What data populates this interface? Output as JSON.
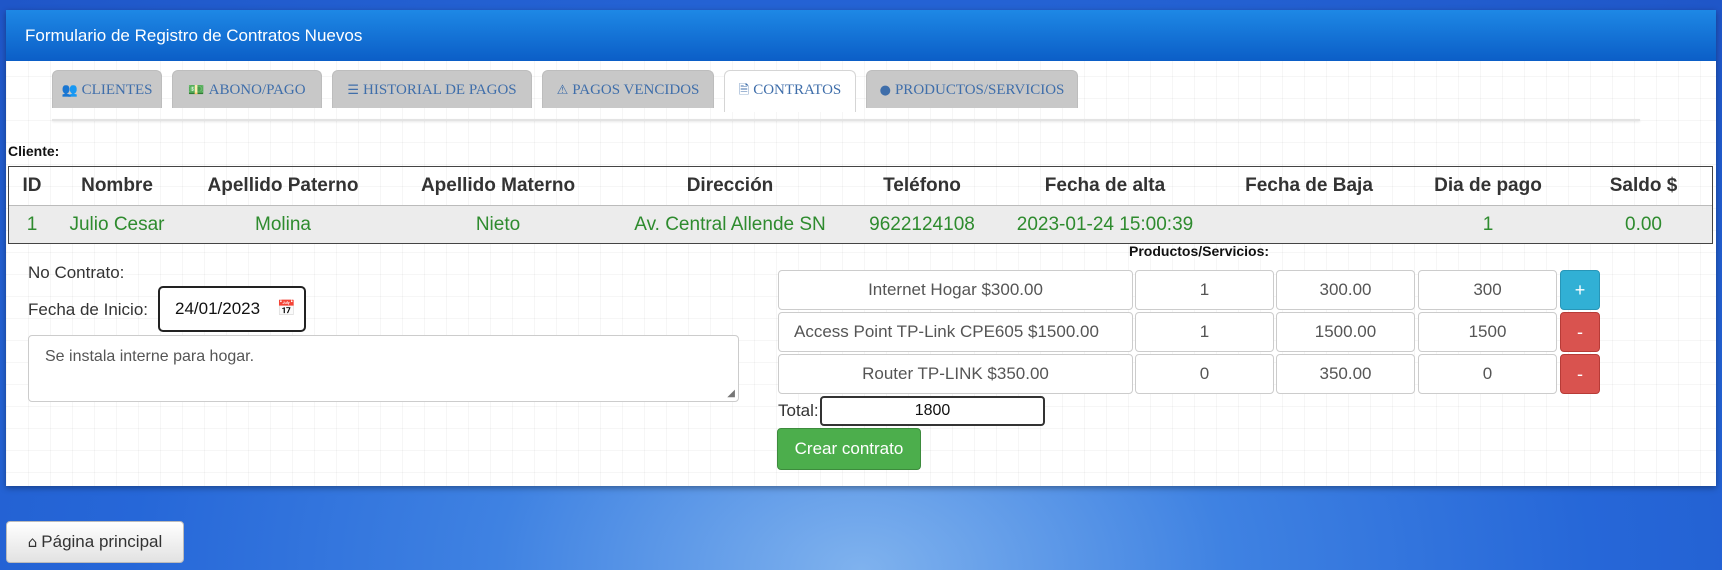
{
  "window": {
    "title": "Formulario de Registro de Contratos Nuevos"
  },
  "tabs": [
    {
      "label": "CLIENTES",
      "icon": "users-icon",
      "glyph": "👥"
    },
    {
      "label": "ABONO/PAGO",
      "icon": "money-icon",
      "glyph": "💵"
    },
    {
      "label": "HISTORIAL DE PAGOS",
      "icon": "list-icon",
      "glyph": "☰"
    },
    {
      "label": "PAGOS VENCIDOS",
      "icon": "warning-icon",
      "glyph": "⚠"
    },
    {
      "label": "CONTRATOS",
      "icon": "document-icon",
      "glyph": "🗎",
      "active": true
    },
    {
      "label": "PRODUCTOS/SERVICIOS",
      "icon": "apple-icon",
      "glyph": "●"
    }
  ],
  "cliente": {
    "label": "Cliente:",
    "headers": [
      "ID",
      "Nombre",
      "Apellido Paterno",
      "Apellido Materno",
      "Dirección",
      "Teléfono",
      "Fecha de alta",
      "Fecha de Baja",
      "Dia de pago",
      "Saldo $"
    ],
    "row": [
      "1",
      "Julio Cesar",
      "Molina",
      "Nieto",
      "Av. Central Allende SN",
      "9622124108",
      "2023-01-24 15:00:39",
      "",
      "1",
      "0.00"
    ]
  },
  "contrato": {
    "no_contrato_label": "No Contrato:",
    "fecha_inicio_label": "Fecha de Inicio:",
    "fecha_inicio_value": "24/01/2023",
    "notes_value": "Se instala interne para hogar."
  },
  "productos": {
    "title": "Productos/Servicios:",
    "rows": [
      {
        "name": "Internet Hogar $300.00",
        "qty": "1",
        "price": "300.00",
        "subtotal": "300",
        "action": "+"
      },
      {
        "name": "Access Point TP-Link CPE605 $1500.00",
        "qty": "1",
        "price": "1500.00",
        "subtotal": "1500",
        "action": "-"
      },
      {
        "name": "Router TP-LINK $350.00",
        "qty": "0",
        "price": "350.00",
        "subtotal": "0",
        "action": "-"
      }
    ],
    "total_label": "Total:",
    "total_value": "1800",
    "create_label": "Crear contrato"
  },
  "footer": {
    "home_label": "Página principal",
    "home_icon": "home-icon"
  },
  "colors": {
    "header": "#0b5ec7",
    "success": "#4cae4c",
    "info": "#31b0d5",
    "danger": "#d9534f",
    "client_text": "#2e8b2e"
  }
}
